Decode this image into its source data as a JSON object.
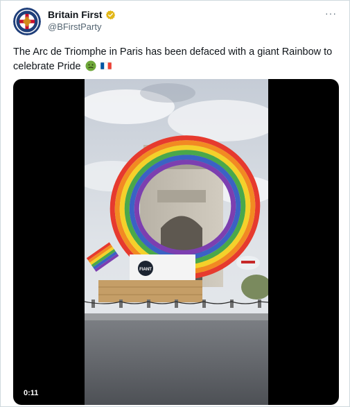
{
  "author": {
    "display_name": "Britain First",
    "handle": "@BFirstParty",
    "verified_icon": "verified-gold-badge",
    "avatar_icon": "party-logo-avatar"
  },
  "menu": {
    "more_label": "···"
  },
  "tweet": {
    "text_line1": "The Arc de Triomphe in Paris has been defaced with a giant Rainbow to",
    "text_line2": "celebrate Pride",
    "emojis": [
      "nauseated-face",
      "flag-france"
    ]
  },
  "media": {
    "type": "video",
    "duration": "0:11",
    "sign_text": "FIANT"
  },
  "colors": {
    "text": "#0f1419",
    "secondary": "#536471",
    "verified_gold": "#e2b719",
    "border": "#cfd9de"
  }
}
